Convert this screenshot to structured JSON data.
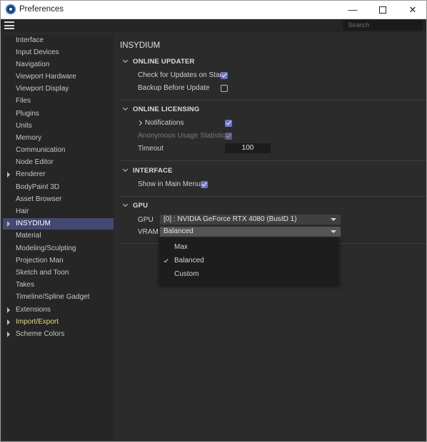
{
  "window": {
    "title": "Preferences",
    "controls": {
      "minimize": "—",
      "close": "✕"
    }
  },
  "toolbar": {
    "search_placeholder": "Search"
  },
  "sidebar": {
    "items": [
      {
        "label": "Interface",
        "expandable": false,
        "selected": false
      },
      {
        "label": "Input Devices",
        "expandable": false,
        "selected": false
      },
      {
        "label": "Navigation",
        "expandable": false,
        "selected": false
      },
      {
        "label": "Viewport Hardware",
        "expandable": false,
        "selected": false
      },
      {
        "label": "Viewport Display",
        "expandable": false,
        "selected": false
      },
      {
        "label": "Files",
        "expandable": false,
        "selected": false
      },
      {
        "label": "Plugins",
        "expandable": false,
        "selected": false
      },
      {
        "label": "Units",
        "expandable": false,
        "selected": false
      },
      {
        "label": "Memory",
        "expandable": false,
        "selected": false
      },
      {
        "label": "Communication",
        "expandable": false,
        "selected": false
      },
      {
        "label": "Node Editor",
        "expandable": false,
        "selected": false
      },
      {
        "label": "Renderer",
        "expandable": true,
        "selected": false
      },
      {
        "label": "BodyPaint 3D",
        "expandable": false,
        "selected": false
      },
      {
        "label": "Asset Browser",
        "expandable": false,
        "selected": false
      },
      {
        "label": "Hair",
        "expandable": false,
        "selected": false
      },
      {
        "label": "INSYDIUM",
        "expandable": true,
        "selected": true
      },
      {
        "label": "Material",
        "expandable": false,
        "selected": false
      },
      {
        "label": "Modeling/Sculpting",
        "expandable": false,
        "selected": false
      },
      {
        "label": "Projection Man",
        "expandable": false,
        "selected": false
      },
      {
        "label": "Sketch and Toon",
        "expandable": false,
        "selected": false
      },
      {
        "label": "Takes",
        "expandable": false,
        "selected": false
      },
      {
        "label": "Timeline/Spline Gadget",
        "expandable": false,
        "selected": false
      },
      {
        "label": "Extensions",
        "expandable": true,
        "selected": false
      },
      {
        "label": "Import/Export",
        "expandable": true,
        "selected": false,
        "highlight": true
      },
      {
        "label": "Scheme Colors",
        "expandable": true,
        "selected": false
      }
    ]
  },
  "main": {
    "title": "INSYDIUM",
    "online_updater": {
      "title": "ONLINE UPDATER",
      "check_updates_label": "Check for Updates on Start",
      "check_updates": true,
      "backup_label": "Backup Before Update",
      "backup": false
    },
    "online_licensing": {
      "title": "ONLINE LICENSING",
      "notifications_label": "Notifications",
      "notifications": true,
      "anonymous_label": "Anonymous Usage Statistics",
      "anonymous": true,
      "timeout_label": "Timeout",
      "timeout_value": "100"
    },
    "interface": {
      "title": "INTERFACE",
      "show_in_menu_label": "Show in Main Menu",
      "show_in_menu": true
    },
    "gpu": {
      "title": "GPU",
      "gpu_label": "GPU",
      "gpu_value": "[0] : NVIDIA GeForce RTX 4080 (BusID 1)",
      "vram_label": "VRAM",
      "vram_value": "Balanced",
      "vram_options": [
        "Max",
        "Balanced",
        "Custom"
      ],
      "vram_selected": "Balanced"
    }
  },
  "colors": {
    "accent": "#6e73c4",
    "selection": "#424a71",
    "highlight_text": "#e5dd7a"
  }
}
